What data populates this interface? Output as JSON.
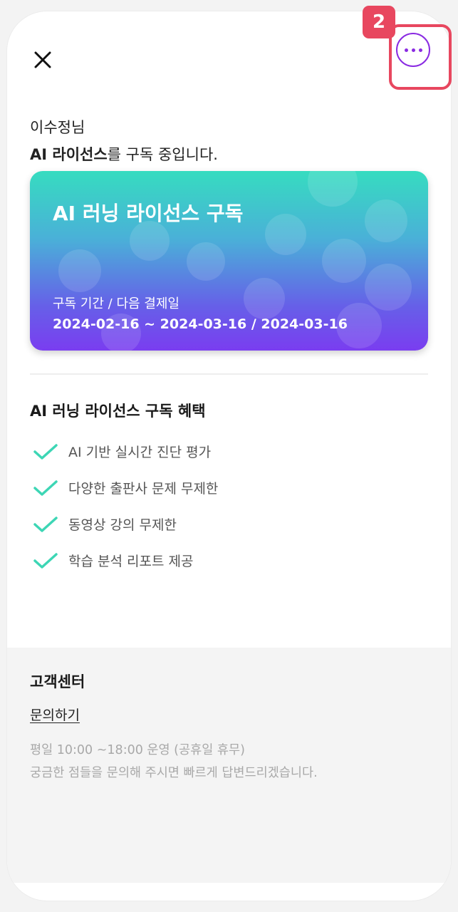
{
  "header": {
    "close_icon": "close-icon",
    "more_icon": "more-horizontal-icon",
    "step_badge": "2",
    "accent_color": "#8a2be2",
    "highlight_color": "#e8475f"
  },
  "greeting": {
    "name_line": "이수정님",
    "product_bold": "AI 라이선스",
    "status_suffix": "를 구독 중입니다."
  },
  "card": {
    "title": "AI 러닝 라이선스 구독",
    "label": "구독 기간 / 다음 결제일",
    "dates": "2024-02-16 ~ 2024-03-16 / 2024-03-16"
  },
  "benefits": {
    "title": "AI 러닝 라이선스 구독 혜택",
    "check_color": "#3dd6b5",
    "items": [
      "AI 기반 실시간 진단 평가",
      "다양한 출판사 문제 무제한",
      "동영상 강의 무제한",
      "학습 분석 리포트 제공"
    ]
  },
  "support": {
    "title": "고객센터",
    "link": "문의하기",
    "hours": "평일 10:00 ~18:00 운영 (공휴일 휴무)",
    "note": "궁금한 점들을 문의해 주시면 빠르게 답변드리겠습니다."
  }
}
